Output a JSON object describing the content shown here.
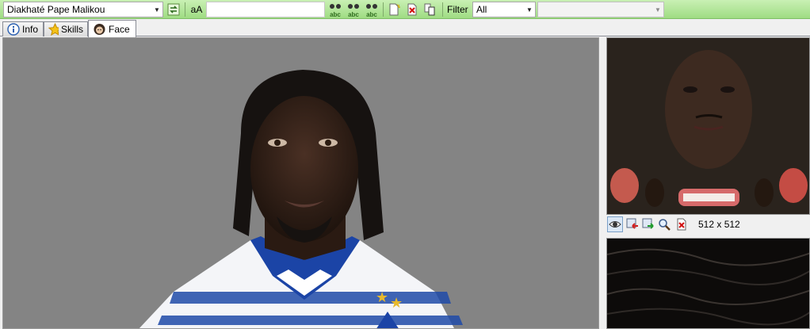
{
  "toolbar": {
    "player_name": "Diakhaté Pape Malikou",
    "case_label": "aA",
    "search_value": "",
    "filter_label": "Filter",
    "filter_value": "All",
    "secondary_value": "",
    "abc_text": "abc"
  },
  "tabs": [
    {
      "label": "Info",
      "icon": "info-icon"
    },
    {
      "label": "Skills",
      "icon": "star-icon"
    },
    {
      "label": "Face",
      "icon": "face-icon",
      "active": true
    }
  ],
  "texture": {
    "size_text": "512 x 512"
  }
}
